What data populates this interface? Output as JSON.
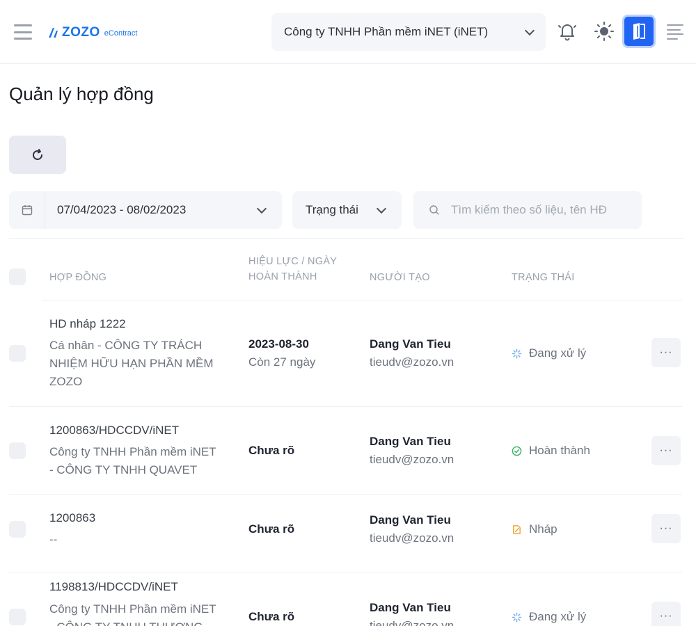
{
  "header": {
    "logo_text": "ZOZO",
    "logo_sub": "eContract",
    "company": "Công ty TNHH Phần mềm iNET (iNET)",
    "icons": [
      "menu-icon",
      "bell-icon",
      "sun-icon",
      "book-icon",
      "align-right-menu-icon"
    ],
    "accent_color": "#2164f3"
  },
  "page": {
    "title": "Quản lý hợp đồng"
  },
  "filters": {
    "date_range": "07/04/2023 - 08/02/2023",
    "status_label": "Trạng thái",
    "search_placeholder": "Tìm kiếm theo số liệu, tên HĐ"
  },
  "table": {
    "columns": {
      "contract": "HỢP ĐỒNG",
      "validity_line1": "HIỆU LỰC / NGÀY",
      "validity_line2": "HOÀN THÀNH",
      "creator": "NGƯỜI TẠO",
      "status": "TRẠNG THÁI"
    },
    "rows": [
      {
        "code": "HD nháp 1222",
        "party_line1": "Cá nhân - CÔNG TY TRÁCH",
        "party_line2": "NHIỆM HỮU HẠN PHẦN MỀM",
        "party_line3": "ZOZO",
        "date": "2023-08-30",
        "remain": "Còn 27 ngày",
        "creator": "Dang Van Tieu",
        "email": "tieudv@zozo.vn",
        "status": "Đang xử lý",
        "status_icon": "processing-icon",
        "more": "···"
      },
      {
        "code": "1200863/HDCCDV/iNET",
        "party_line1": "Công ty TNHH Phần mềm iNET",
        "party_line2": "- CÔNG TY TNHH QUAVET",
        "date": "Chưa rõ",
        "creator": "Dang Van Tieu",
        "email": "tieudv@zozo.vn",
        "status": "Hoàn thành",
        "status_icon": "check-circle-icon",
        "more": "···"
      },
      {
        "code": "1200863",
        "party_line1": "--",
        "date": "Chưa rõ",
        "creator": "Dang Van Tieu",
        "email": "tieudv@zozo.vn",
        "status": "Nháp",
        "status_icon": "draft-icon",
        "more": "···"
      },
      {
        "code": "1198813/HDCCDV/iNET",
        "party_line1": "Công ty TNHH Phần mềm iNET",
        "party_line2": "- CÔNG TY TNHH THƯƠNG",
        "date": "Chưa rõ",
        "creator": "Dang Van Tieu",
        "email": "tieudv@zozo.vn",
        "status": "Đang xử lý",
        "status_icon": "processing-icon",
        "more": "···"
      }
    ]
  }
}
